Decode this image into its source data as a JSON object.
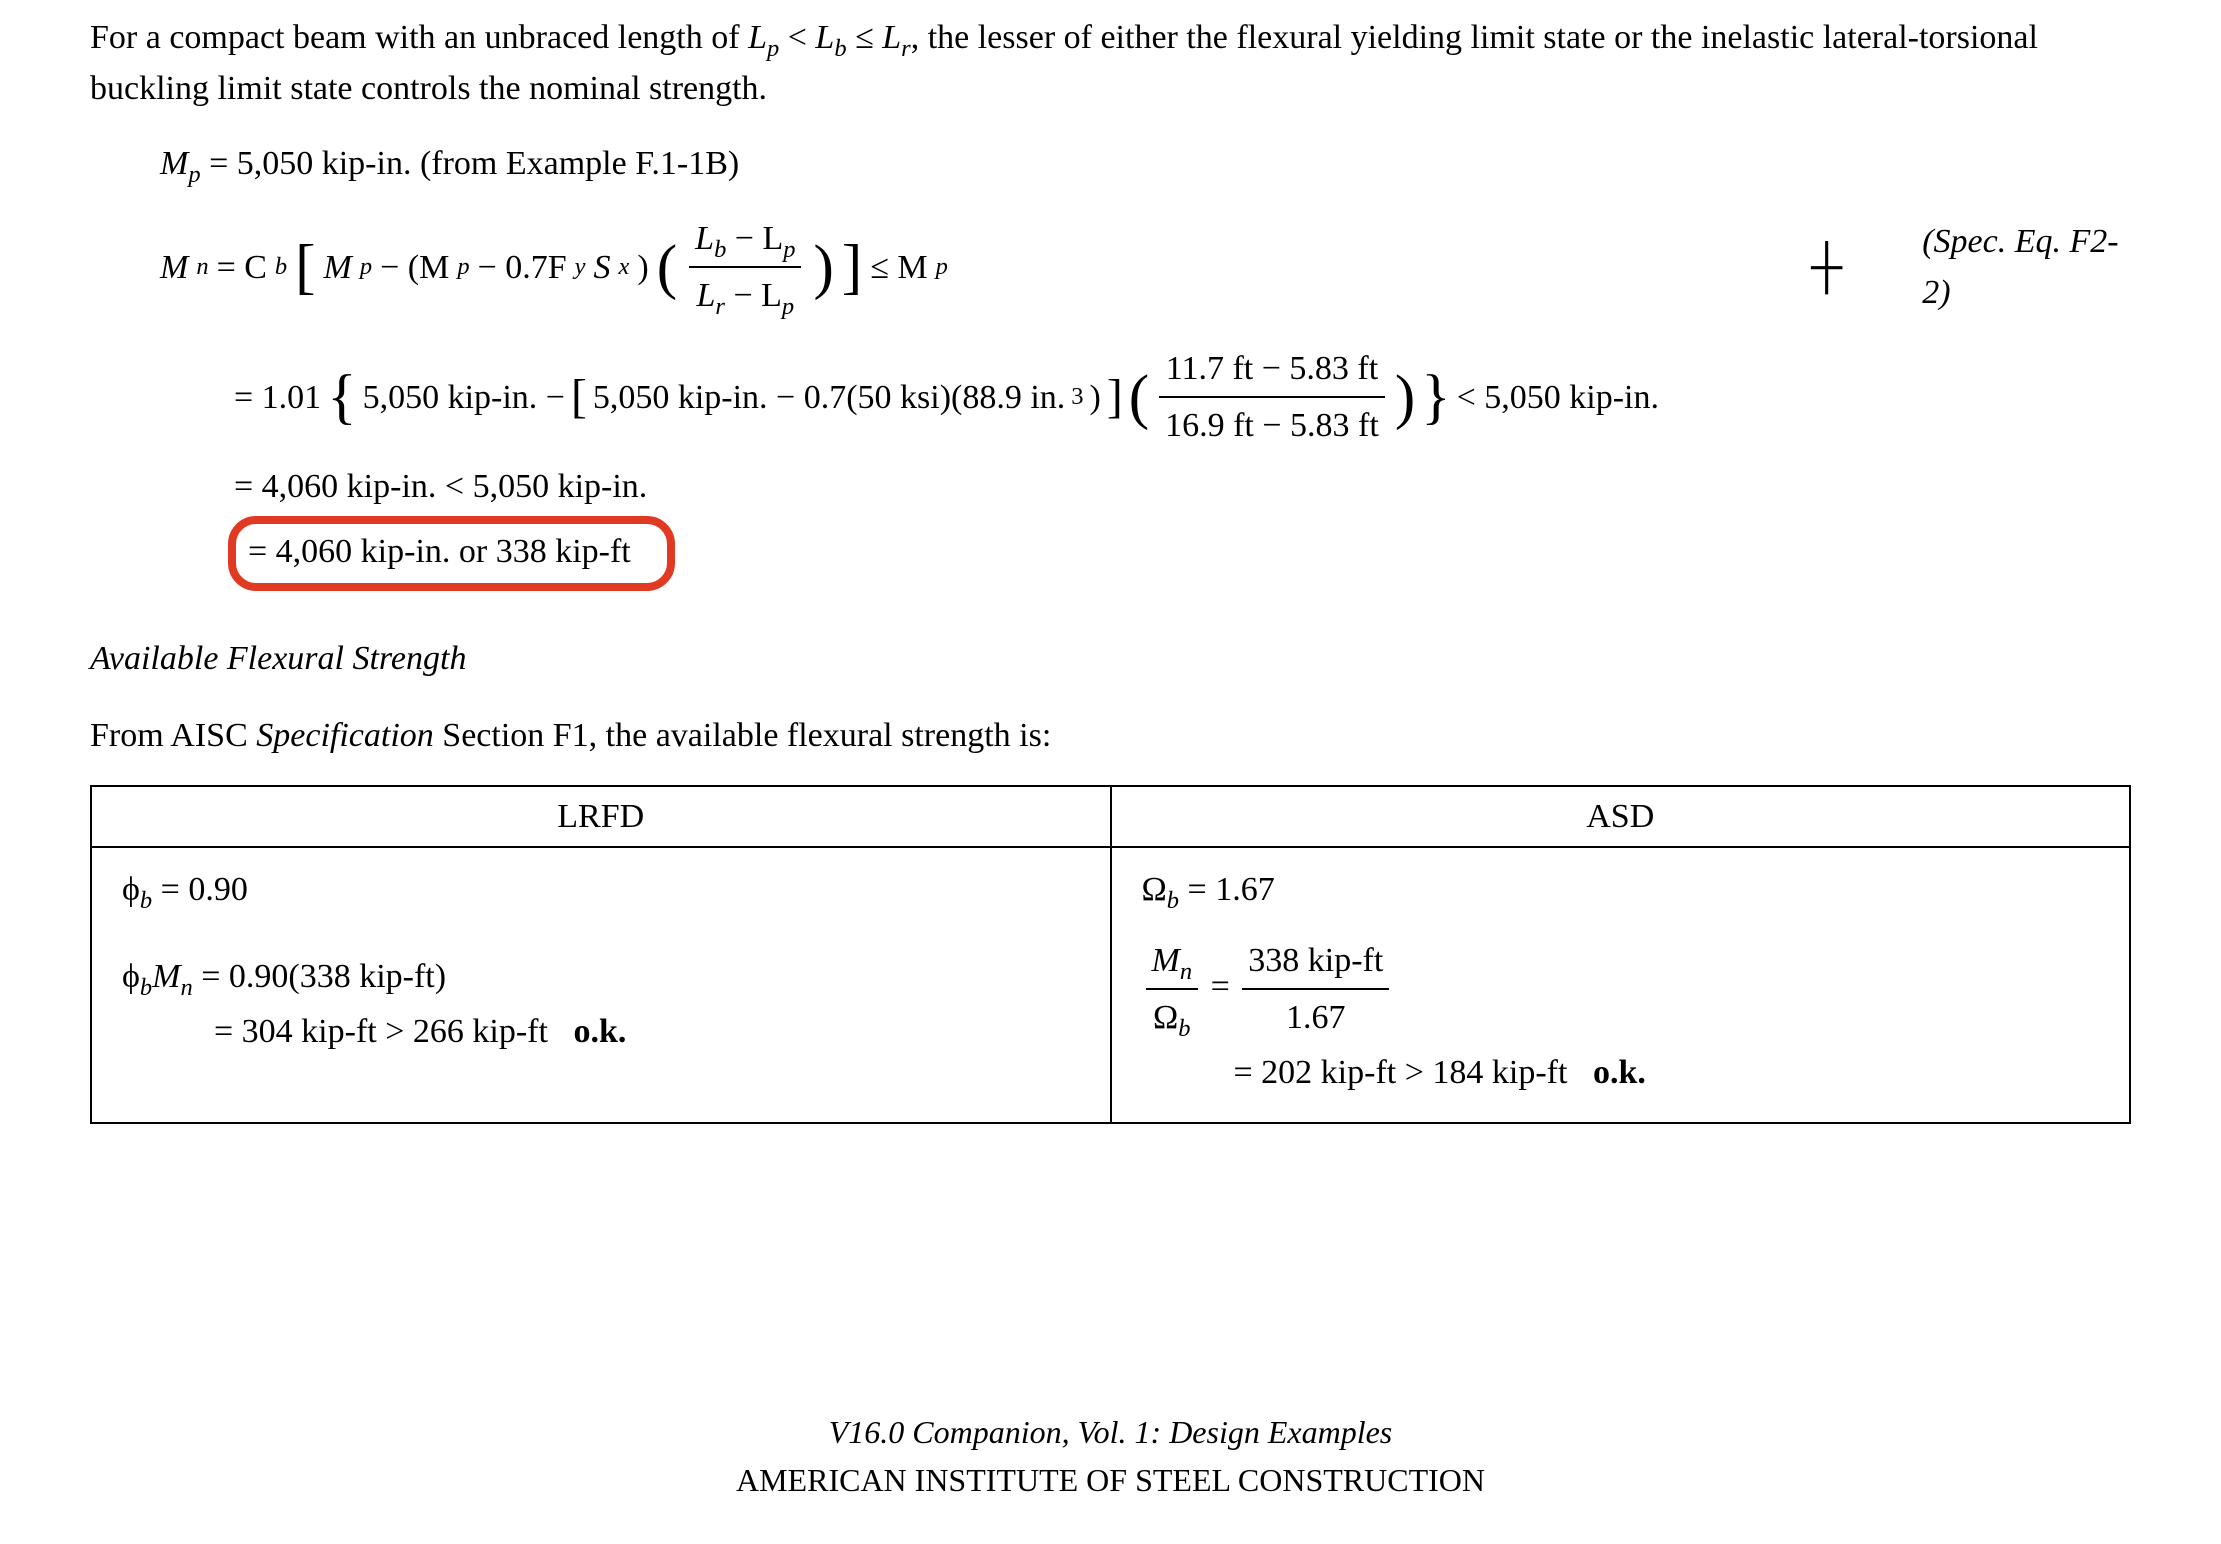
{
  "intro_paragraph": "For a compact beam with an unbraced length of Lₚ < L_b ≤ L_r, the lesser of either the flexural yielding limit state or the inelastic lateral-torsional buckling limit state controls the nominal strength.",
  "mp_line": {
    "label": "M",
    "sub": "p",
    "eq": " = 5,050 kip-in. (from Example F.1-1B)"
  },
  "mn_equation": {
    "lhs": "M",
    "lhs_sub": "n",
    "rhs1": " = C",
    "rhs1_sub": "b",
    "term_Mp": "M",
    "term_Mp_sub": "p",
    "minus_open": " − (M",
    "minus_mid": " − 0.7F",
    "Fy_sub": "y",
    "Sx": "S",
    "Sx_sub": "x",
    "close1": ")",
    "frac_num_parts": [
      "L",
      "b",
      " − L",
      "p"
    ],
    "frac_den_parts": [
      "L",
      "r",
      " − L",
      "p"
    ],
    "leq": " ≤ M",
    "leq_sub": "p",
    "ref": "(Spec. Eq. F2-2)"
  },
  "numeric_sub": {
    "lead": "= 1.01",
    "big_open": "{",
    "inner1": "5,050 kip-in. −",
    "bracket_open": "[",
    "inner2": "5,050 kip-in. − 0.7(50 ksi)(88.9 in.",
    "cubed": "3",
    "inner2_close": ")",
    "bracket_close": "]",
    "frac_num": "11.7 ft − 5.83 ft",
    "frac_den": "16.9 ft − 5.83 ft",
    "big_close": "}",
    "tail": " < 5,050 kip-in."
  },
  "result_line1": "= 4,060 kip-in. < 5,050 kip-in.",
  "result_line2": "= 4,060 kip-in. or 338 kip-ft",
  "avail_heading": "Available Flexural Strength",
  "avail_text": "From AISC Specification Section F1, the available flexural strength is:",
  "avail_text_prefix": "From AISC ",
  "avail_text_spec": "Specification",
  "avail_text_suffix": " Section F1, the available flexural strength is:",
  "table": {
    "lrfd": {
      "header": "LRFD",
      "phi_line": "ϕ_b = 0.90",
      "phi": "ϕ",
      "phi_sub": "b",
      "phi_val": " = 0.90",
      "calc1_pre": "ϕ",
      "calc1_sub1": "b",
      "calc1_M": "M",
      "calc1_sub2": "n",
      "calc1_rest": " = 0.90(338 kip-ft)",
      "calc2": "= 304 kip-ft > 266 kip-ft",
      "ok": "o.k."
    },
    "asd": {
      "header": "ASD",
      "omega": "Ω",
      "omega_sub": "b",
      "omega_val": " = 1.67",
      "frac_num_M": "M",
      "frac_num_sub": "n",
      "frac_den_O": "Ω",
      "frac_den_sub": "b",
      "eq": " = ",
      "frac2_num": "338 kip-ft",
      "frac2_den": "1.67",
      "calc2": "= 202 kip-ft > 184 kip-ft",
      "ok": "o.k."
    }
  },
  "footer": {
    "line1": "V16.0 Companion, Vol. 1: Design Examples",
    "line2": "AMERICAN INSTITUTE OF STEEL CONSTRUCTION"
  },
  "chart_data": {
    "type": "table",
    "columns": [
      "LRFD",
      "ASD"
    ],
    "rows": [
      {
        "LRFD": "ϕ_b = 0.90",
        "ASD": "Ω_b = 1.67"
      },
      {
        "LRFD": "ϕ_b M_n = 0.90(338 kip-ft) = 304 kip-ft > 266 kip-ft  o.k.",
        "ASD": "M_n / Ω_b = 338 kip-ft / 1.67 = 202 kip-ft > 184 kip-ft  o.k."
      }
    ]
  }
}
